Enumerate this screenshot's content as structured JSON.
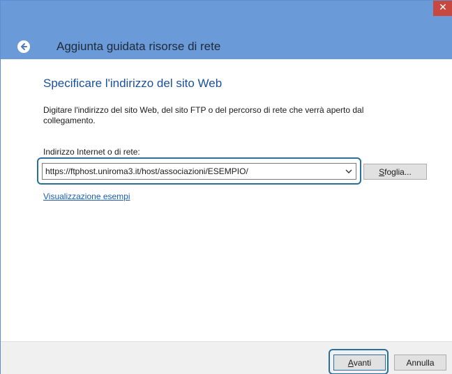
{
  "window": {
    "close_symbol": "✕",
    "colors": {
      "titlebar": "#6b9ad8",
      "close": "#c74841",
      "accent": "#1a4f9c",
      "focus": "#2a6e9b"
    }
  },
  "header": {
    "back_icon": "back-arrow-icon",
    "title": "Aggiunta guidata risorse di rete"
  },
  "main": {
    "section_title": "Specificare l'indirizzo del sito Web",
    "description": "Digitare l'indirizzo del sito Web, del sito FTP o del percorso di rete che verrà aperto dal collegamento.",
    "field_label": "Indirizzo Internet o di rete:",
    "url_value": "https://ftphost.uniroma3.it/host/associazioni/ESEMPIO/",
    "browse_accesskey": "S",
    "browse_rest": "foglia...",
    "examples_link": "Visualizzazione esempi"
  },
  "footer": {
    "next_accesskey": "A",
    "next_rest": "vanti",
    "cancel_label": "Annulla"
  }
}
